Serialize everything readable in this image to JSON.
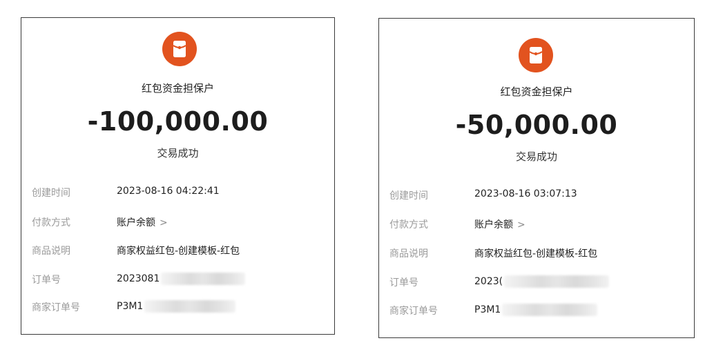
{
  "receipts": [
    {
      "title": "红包资金担保户",
      "amount": "-100,000.00",
      "status": "交易成功",
      "rows": [
        {
          "label": "创建时间",
          "value": "2023-08-16 04:22:41"
        },
        {
          "label": "付款方式",
          "value": "账户余额",
          "chevron": ">"
        },
        {
          "label": "商品说明",
          "value": "商家权益红包-创建模板-红包"
        },
        {
          "label": "订单号",
          "value": "2023081"
        },
        {
          "label": "商家订单号",
          "value": "P3M1"
        }
      ]
    },
    {
      "title": "红包资金担保户",
      "amount": "-50,000.00",
      "status": "交易成功",
      "rows": [
        {
          "label": "创建时间",
          "value": "2023-08-16 03:07:13"
        },
        {
          "label": "付款方式",
          "value": "账户余额",
          "chevron": ">"
        },
        {
          "label": "商品说明",
          "value": "商家权益红包-创建模板-红包"
        },
        {
          "label": "订单号",
          "value": "2023("
        },
        {
          "label": "商家订单号",
          "value": "P3M1"
        }
      ]
    }
  ],
  "colors": {
    "icon_background": "#e2531f",
    "label_text": "#9a9a9a",
    "value_text": "#222222"
  },
  "icons": {
    "header_icon": "red-envelope-icon",
    "chevron": "chevron-right-icon"
  }
}
